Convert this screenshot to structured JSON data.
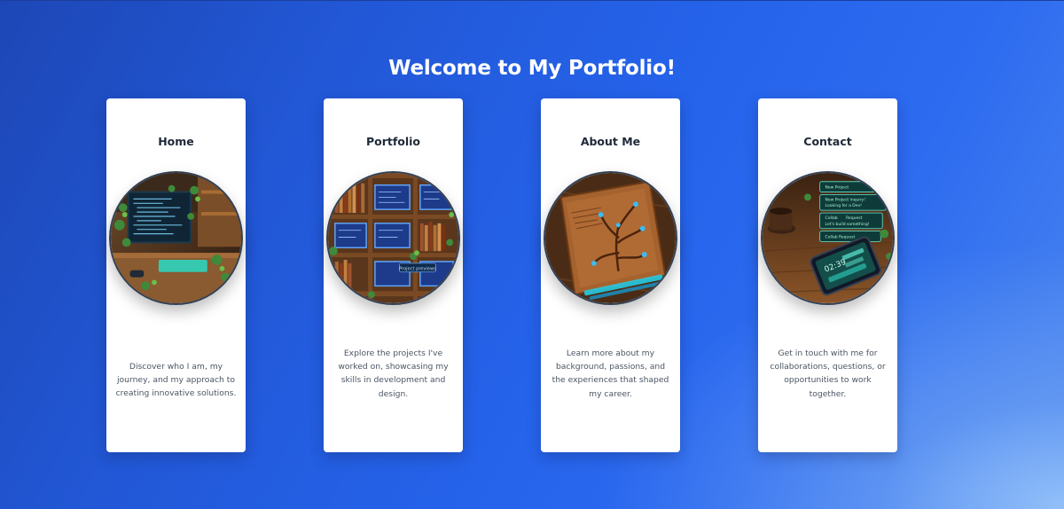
{
  "page": {
    "heading": "Welcome to My Portfolio!"
  },
  "colors": {
    "background_start": "#1d47b6",
    "background_mid": "#2563eb",
    "background_corner_glow": "#93c5fd",
    "card_background": "#ffffff",
    "card_title": "#1f2937",
    "card_text": "#4b5563",
    "image_border": "#334155"
  },
  "cards": [
    {
      "title": "Home",
      "image_icon": "coding-desk-illustration",
      "description": "Discover who I am, my journey, and my approach to creating innovative solutions."
    },
    {
      "title": "Portfolio",
      "image_icon": "bookshelf-screens-illustration",
      "image_label": "Project previews",
      "description": "Explore the projects I've worked on, showcasing my skills in development and design."
    },
    {
      "title": "About Me",
      "image_icon": "tree-book-illustration",
      "description": "Learn more about my background, passions, and the experiences that shaped my career."
    },
    {
      "title": "Contact",
      "image_icon": "phone-notifications-illustration",
      "image_notifications": [
        "New Project",
        "New Project inquiry!",
        "Looking for a Dev!",
        "Collab",
        "Request",
        "Let's build something!",
        "Collab Request"
      ],
      "image_clock": "02:39",
      "description": "Get in touch with me for collaborations, questions, or opportunities to work together."
    }
  ]
}
